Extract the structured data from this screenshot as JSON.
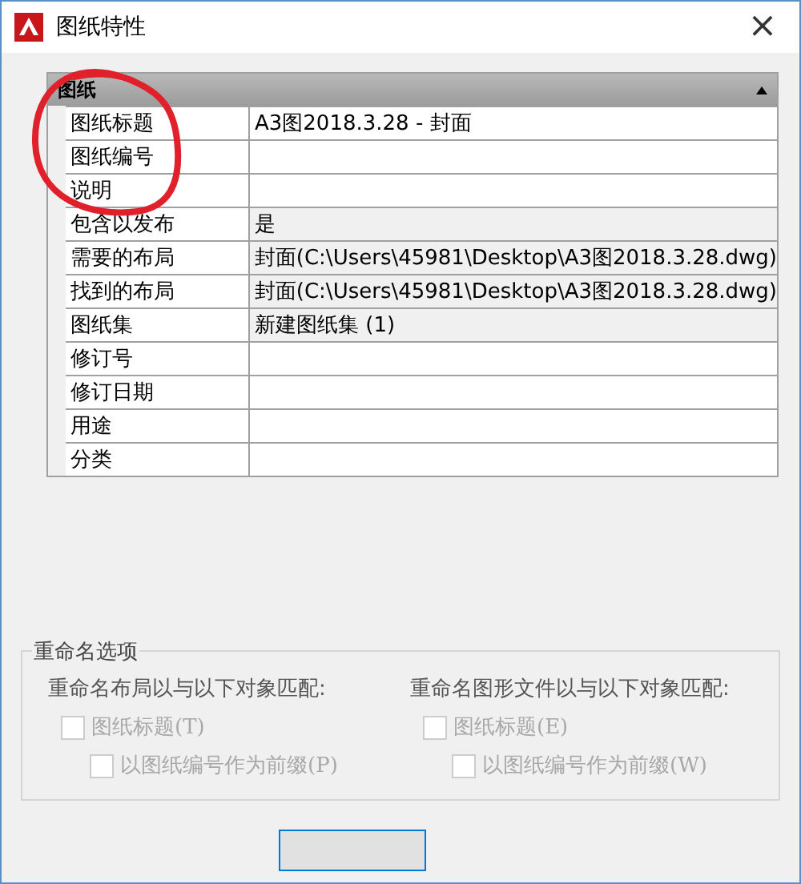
{
  "window": {
    "title": "图纸特性",
    "close": "×"
  },
  "properties": {
    "section": {
      "title": "图纸",
      "expanded": true
    },
    "rows": [
      {
        "label": "图纸标题",
        "value": "A3图2018.3.28 - 封面",
        "readonly": false
      },
      {
        "label": "图纸编号",
        "readonly": false
      },
      {
        "label": "说明",
        "readonly": false
      },
      {
        "label": "包含以发布",
        "value": "是",
        "readonly": true
      },
      {
        "label": "需要的布局",
        "value": "封面(C:\\Users\\45981\\Desktop\\A3图2018.3.28.dwg)",
        "readonly": true
      },
      {
        "label": "找到的布局",
        "value": "封面(C:\\Users\\45981\\Desktop\\A3图2018.3.28.dwg)",
        "readonly": true
      },
      {
        "label": "图纸集",
        "value": "新建图纸集 (1)",
        "readonly": true
      },
      {
        "label": "修订号",
        "readonly": false
      },
      {
        "label": "修订日期",
        "readonly": false
      },
      {
        "label": "用途",
        "readonly": false
      },
      {
        "label": "分类",
        "readonly": false
      }
    ]
  },
  "annotation": {
    "kind": "circle"
  },
  "rename_options": {
    "title": "重命名选项",
    "columns": [
      {
        "heading": "重命名布局以与以下对象匹配:",
        "options": [
          {
            "label": "图纸标题(T)",
            "checked": false,
            "disabled": true
          },
          {
            "label": "以图纸编号作为前缀(P)",
            "checked": false,
            "disabled": true
          }
        ]
      },
      {
        "heading": "重命名图形文件以与以下对象匹配:",
        "options": [
          {
            "label": "图纸标题(E)",
            "checked": false,
            "disabled": true
          },
          {
            "label": "以图纸编号作为前缀(W)",
            "checked": false,
            "disabled": true
          }
        ]
      }
    ]
  },
  "buttons": [
    {
      "kind": "blank"
    }
  ]
}
